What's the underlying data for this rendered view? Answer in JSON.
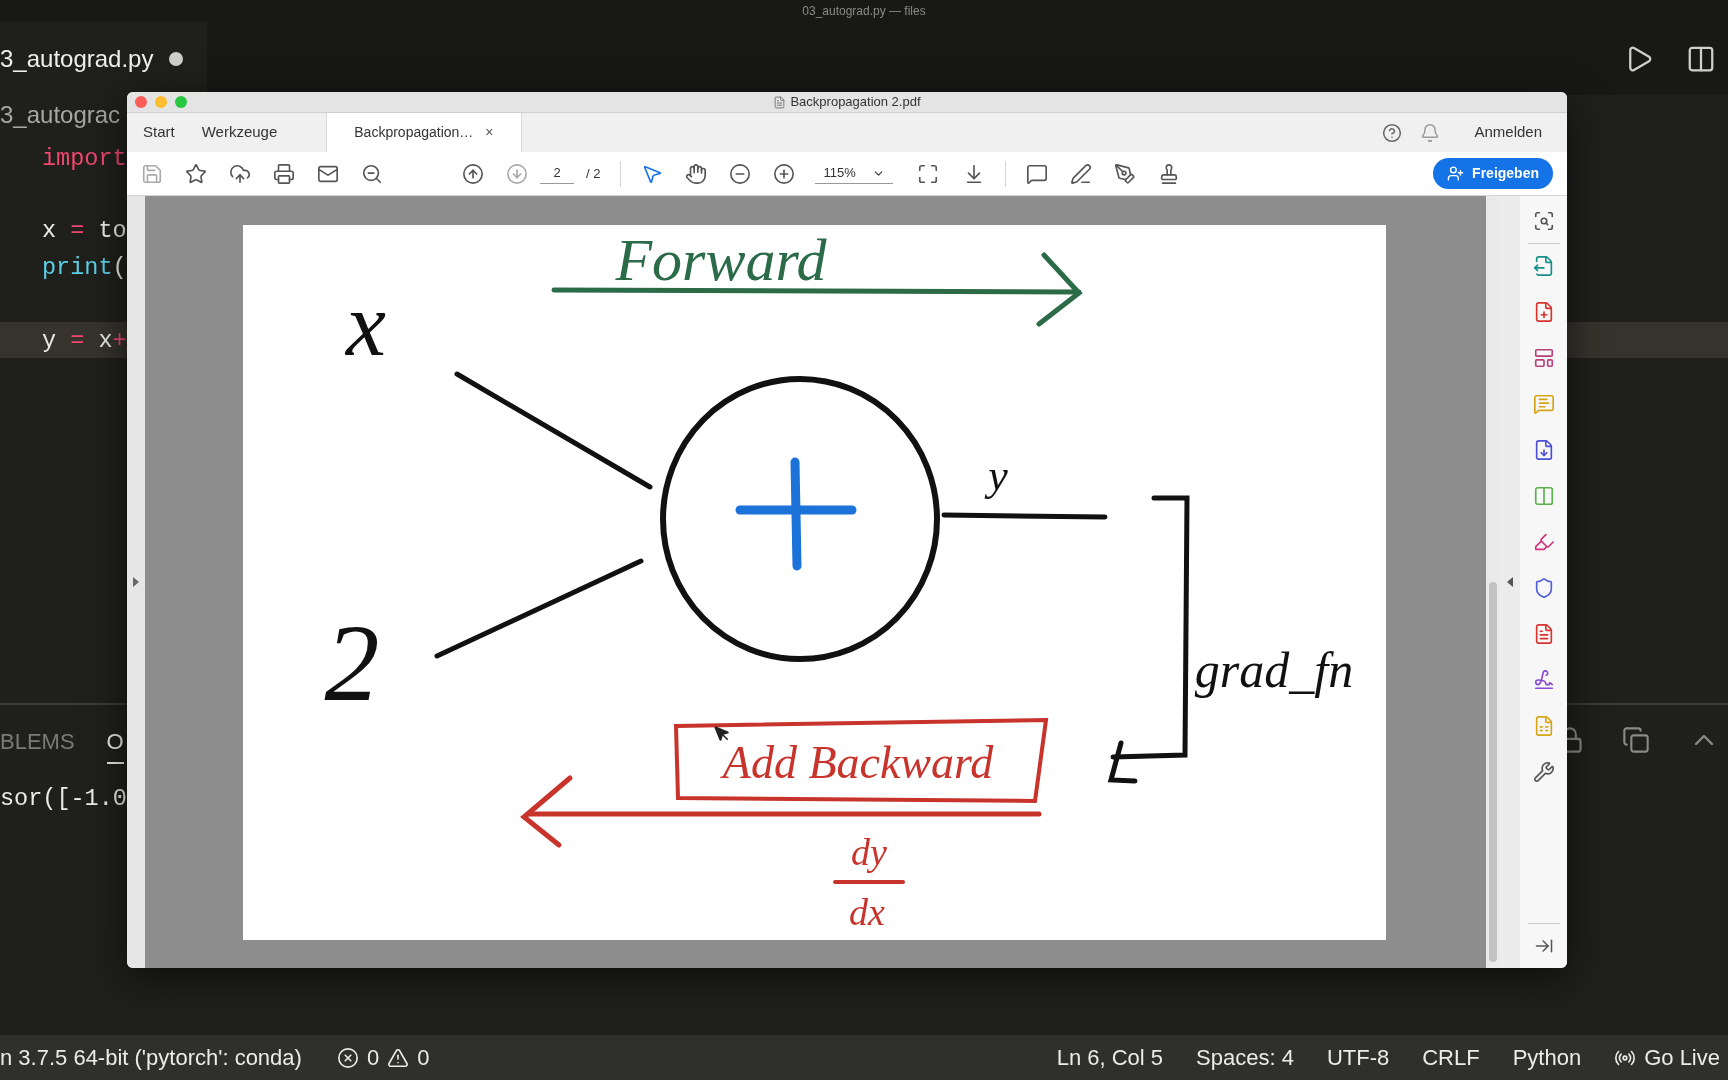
{
  "vscode": {
    "title": "03_autograd.py — files",
    "tab": {
      "label": "3_autograd.py",
      "modified": true
    },
    "breadcrumb": "3_autograc",
    "code_lines": [
      {
        "kind": "code",
        "current": false,
        "tokens": [
          {
            "text": "import",
            "kind": "keyword"
          }
        ]
      },
      {
        "kind": "blank",
        "current": false
      },
      {
        "kind": "code",
        "current": false,
        "tokens": [
          {
            "text": "x ",
            "kind": "name"
          },
          {
            "text": "=",
            "kind": "operator"
          },
          {
            "text": " to",
            "kind": "name"
          }
        ]
      },
      {
        "kind": "code",
        "current": false,
        "tokens": [
          {
            "text": "print",
            "kind": "builtin"
          },
          {
            "text": "(",
            "kind": "name"
          }
        ]
      },
      {
        "kind": "blank",
        "current": false
      },
      {
        "kind": "code",
        "current": true,
        "tokens": [
          {
            "text": "y ",
            "kind": "name"
          },
          {
            "text": "=",
            "kind": "operator"
          },
          {
            "text": " x",
            "kind": "name"
          },
          {
            "text": "+",
            "kind": "operator"
          }
        ]
      }
    ],
    "panel_tabs": [
      {
        "label": "BLEMS",
        "selected": false
      },
      {
        "label": "O",
        "selected": true
      }
    ],
    "output": "sor([-1.0",
    "status_bar": {
      "interpreter": "n 3.7.5 64-bit ('pytorch': conda)",
      "errors": "0",
      "warnings": "0",
      "right": [
        "Ln 6, Col 5",
        "Spaces: 4",
        "UTF-8",
        "CRLF",
        "Python"
      ],
      "go_live": "Go Live"
    }
  },
  "acrobat": {
    "title": "Backpropagation 2.pdf",
    "tabs": [
      {
        "label": "Start",
        "selected": false,
        "kind": "menu"
      },
      {
        "label": "Werkzeuge",
        "selected": false,
        "kind": "menu"
      },
      {
        "label": "Backpropagation…",
        "selected": true,
        "kind": "document",
        "close": "×"
      }
    ],
    "sign_in": "Anmelden",
    "page": "2",
    "page_count": "/ 2",
    "zoom": "115%",
    "share": "Freigeben",
    "drawing": {
      "forward": "Forward",
      "x": "x",
      "two": "2",
      "y": "y",
      "grad_fn": "grad_fn",
      "add_backward": "Add Backward",
      "dy": "dy",
      "dx": "dx"
    }
  }
}
